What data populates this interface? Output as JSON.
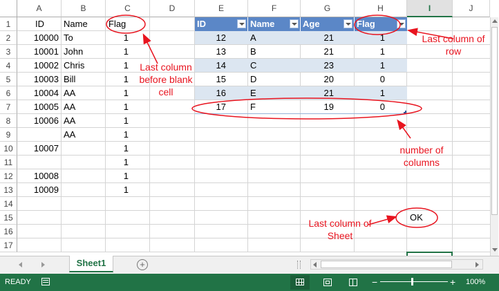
{
  "columns": [
    "A",
    "B",
    "C",
    "D",
    "E",
    "F",
    "G",
    "H",
    "I",
    "J"
  ],
  "rows": [
    "1",
    "2",
    "3",
    "4",
    "5",
    "6",
    "7",
    "8",
    "9",
    "10",
    "11",
    "12",
    "13",
    "14",
    "15",
    "16",
    "17"
  ],
  "left_table": {
    "headers": [
      "ID",
      "Name",
      "Flag"
    ],
    "rows": [
      [
        "10000",
        "To",
        "1"
      ],
      [
        "10001",
        "John",
        "1"
      ],
      [
        "10002",
        "Chris",
        "1"
      ],
      [
        "10003",
        "Bill",
        "1"
      ],
      [
        "10004",
        "AA",
        "1"
      ],
      [
        "10005",
        "AA",
        "1"
      ],
      [
        "10006",
        "AA",
        "1"
      ],
      [
        "",
        "AA",
        "1"
      ],
      [
        "10007",
        "",
        "1"
      ],
      [
        "",
        "",
        "1"
      ],
      [
        "10008",
        "",
        "1"
      ],
      [
        "10009",
        "",
        "1"
      ]
    ]
  },
  "excel_table": {
    "headers": [
      "ID",
      "Name",
      "Age",
      "Flag"
    ],
    "rows": [
      [
        "12",
        "A",
        "21",
        "1"
      ],
      [
        "13",
        "B",
        "21",
        "1"
      ],
      [
        "14",
        "C",
        "23",
        "1"
      ],
      [
        "15",
        "D",
        "20",
        "0"
      ],
      [
        "16",
        "E",
        "21",
        "1"
      ],
      [
        "17",
        "F",
        "19",
        "0"
      ]
    ],
    "header_color": "#5b87c7",
    "band_color": "#dce6f1"
  },
  "ok_text": "OK",
  "annotations": {
    "before_blank": "Last column before blank cell",
    "last_of_row": "Last column of row",
    "num_columns": "number of columns",
    "last_of_sheet": "Last column of Sheet",
    "color": "#e8141f"
  },
  "tabs": {
    "sheet": "Sheet1"
  },
  "status": {
    "ready": "READY",
    "zoom": "100%"
  },
  "accent": "#217346"
}
